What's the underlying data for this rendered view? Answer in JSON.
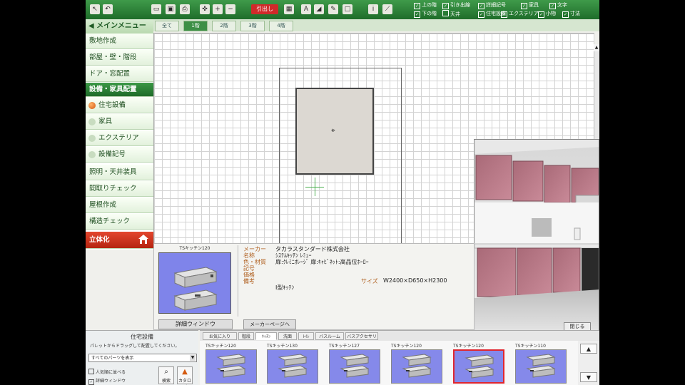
{
  "toolbar": {
    "red_button": "引出し",
    "checkboxes": [
      {
        "label": "上の階",
        "checked": true
      },
      {
        "label": "引き出線",
        "checked": true
      },
      {
        "label": "詳細記号",
        "checked": true
      },
      {
        "label": "家具",
        "checked": true
      },
      {
        "label": "文字",
        "checked": true
      },
      {
        "label": "下の階",
        "checked": true
      },
      {
        "label": "天井",
        "checked": false
      },
      {
        "label": "住宅設備",
        "checked": true
      },
      {
        "label": "エクステリア",
        "checked": true
      },
      {
        "label": "小物",
        "checked": true
      },
      {
        "label": "寸法",
        "checked": true
      }
    ]
  },
  "sidebar": {
    "main_menu": "◀ メインメニュー",
    "items": [
      {
        "label": "敷地作成"
      },
      {
        "label": "部屋・壁・階段"
      },
      {
        "label": "ドア・窓配置"
      },
      {
        "label": "設備・家具配置"
      },
      {
        "label": "住宅設備"
      },
      {
        "label": "家具"
      },
      {
        "label": "エクステリア"
      },
      {
        "label": "設備記号"
      },
      {
        "label": "照明・天井装具"
      },
      {
        "label": "間取りチェック"
      },
      {
        "label": "屋根作成"
      },
      {
        "label": "構造チェック"
      },
      {
        "label": "立体化"
      }
    ]
  },
  "tabs": [
    "全て",
    "1階",
    "2階",
    "3階",
    "4階"
  ],
  "canvas": {
    "cursor": "⌖"
  },
  "preview": {
    "close_label": "閉じる"
  },
  "detail": {
    "thumb_title": "TSキッチン120",
    "window_button": "詳細ウィンドウ",
    "maker_button": "メーカーページへ",
    "fields": [
      {
        "label": "メーカー",
        "value": "タカラスタンダード株式会社"
      },
      {
        "label": "名称",
        "value": "ｼｽﾃﾑｷｯﾁﾝ ﾚﾐｭｰ"
      },
      {
        "label": "色・材質",
        "value": "扉:ｸﾚﾐﾆｵﾚｰｼﾞ 扉:ｷｬﾋﾞﾈｯﾄ:高品位ﾎｰﾛｰ"
      },
      {
        "label": "記号",
        "value": ""
      },
      {
        "label": "価格",
        "value": ""
      },
      {
        "label": "備考",
        "value": "I型ｷｯﾁﾝ"
      }
    ],
    "size_label": "サイズ",
    "size_value": "W2400×D650×H2300"
  },
  "palette": {
    "title": "住宅設備",
    "hint": "パレットからドラッグして配置してください。",
    "select_value": "すべてのパーツを表示",
    "check1": "人気順に並べる",
    "check2": "詳細ウィンドウ",
    "search_button": "検索",
    "extra_button": "カタログ",
    "tabs": [
      "お気に入り",
      "階段",
      "ｷｯﾁﾝ",
      "洗面",
      "ﾄｲﾚ",
      "バスルーム",
      "バスアクセサリ"
    ],
    "items": [
      {
        "label": "TSキッチン120"
      },
      {
        "label": "TSキッチン130"
      },
      {
        "label": "TSキッチン127"
      },
      {
        "label": "TSキッチン120"
      },
      {
        "label": "TSキッチン120"
      },
      {
        "label": "TSキッチン110"
      }
    ],
    "scroll_up": "▲",
    "scroll_down": "▼"
  },
  "colors": {
    "toolbar_green": "#2e8a3a",
    "selected_border": "#e0262f",
    "sidebar_red": "#c93418"
  }
}
